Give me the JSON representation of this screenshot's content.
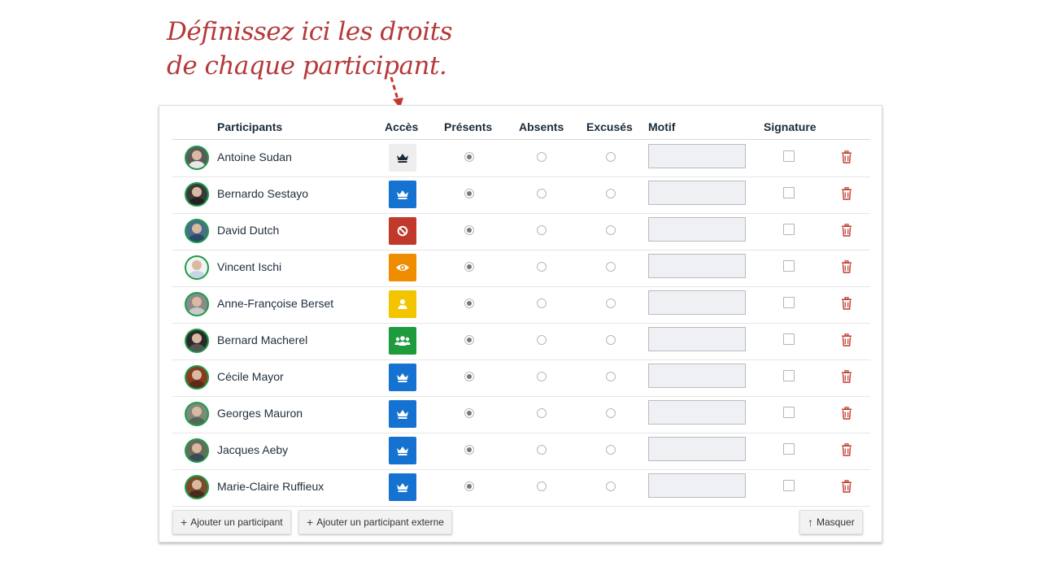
{
  "annotation": {
    "line1": "Définissez ici les droits",
    "line2": "de chaque participant."
  },
  "headers": {
    "participants": "Participants",
    "acces": "Accès",
    "presents": "Présents",
    "absents": "Absents",
    "excuses": "Excusés",
    "motif": "Motif",
    "signature": "Signature"
  },
  "participants": [
    {
      "name": "Antoine Sudan",
      "access_icon": "crown-icon",
      "access_color": "#eeeeee",
      "icon_color": "#1c2b3a",
      "attendance": "present",
      "signed": false,
      "avatar_bg": "#5a5a5a",
      "avatar_shirt": "#e8e8e8"
    },
    {
      "name": "Bernardo Sestayo",
      "access_icon": "crown-icon",
      "access_color": "#1572d0",
      "icon_color": "#ffffff",
      "attendance": "present",
      "signed": false,
      "avatar_bg": "#3a3a3a",
      "avatar_shirt": "#222222"
    },
    {
      "name": "David Dutch",
      "access_icon": "ban-icon",
      "access_color": "#c0392b",
      "icon_color": "#ffffff",
      "attendance": "present",
      "signed": false,
      "avatar_bg": "#4a6d8a",
      "avatar_shirt": "#2b4a6a"
    },
    {
      "name": "Vincent Ischi",
      "access_icon": "eye-icon",
      "access_color": "#f08c00",
      "icon_color": "#ffffff",
      "attendance": "present",
      "signed": false,
      "avatar_bg": "#f3f3f3",
      "avatar_shirt": "#c7d6e6"
    },
    {
      "name": "Anne-Françoise Berset",
      "access_icon": "user-icon",
      "access_color": "#f2c500",
      "icon_color": "#ffffff",
      "attendance": "present",
      "signed": false,
      "avatar_bg": "#8a8a8a",
      "avatar_shirt": "#c9c9c9"
    },
    {
      "name": "Bernard Macherel",
      "access_icon": "users-icon",
      "access_color": "#1e9b3c",
      "icon_color": "#ffffff",
      "attendance": "present",
      "signed": false,
      "avatar_bg": "#2a2a2a",
      "avatar_shirt": "#555555"
    },
    {
      "name": "Cécile Mayor",
      "access_icon": "crown-icon",
      "access_color": "#1572d0",
      "icon_color": "#ffffff",
      "attendance": "present",
      "signed": false,
      "avatar_bg": "#8a3a20",
      "avatar_shirt": "#5a2a1a"
    },
    {
      "name": "Georges Mauron",
      "access_icon": "crown-icon",
      "access_color": "#1572d0",
      "icon_color": "#ffffff",
      "attendance": "present",
      "signed": false,
      "avatar_bg": "#7d8a7a",
      "avatar_shirt": "#556655"
    },
    {
      "name": "Jacques Aeby",
      "access_icon": "crown-icon",
      "access_color": "#1572d0",
      "icon_color": "#ffffff",
      "attendance": "present",
      "signed": false,
      "avatar_bg": "#6a6a5a",
      "avatar_shirt": "#3a4a5a"
    },
    {
      "name": "Marie-Claire Ruffieux",
      "access_icon": "crown-icon",
      "access_color": "#1572d0",
      "icon_color": "#ffffff",
      "attendance": "present",
      "signed": false,
      "avatar_bg": "#7a4a2a",
      "avatar_shirt": "#4a2a1a"
    }
  ],
  "buttons": {
    "add_participant": "Ajouter un participant",
    "add_external": "Ajouter un participant externe",
    "hide": "Masquer"
  },
  "colors": {
    "annotation": "#b5393a",
    "avatar_border": "#1d9c49",
    "trash": "#c0392b"
  }
}
